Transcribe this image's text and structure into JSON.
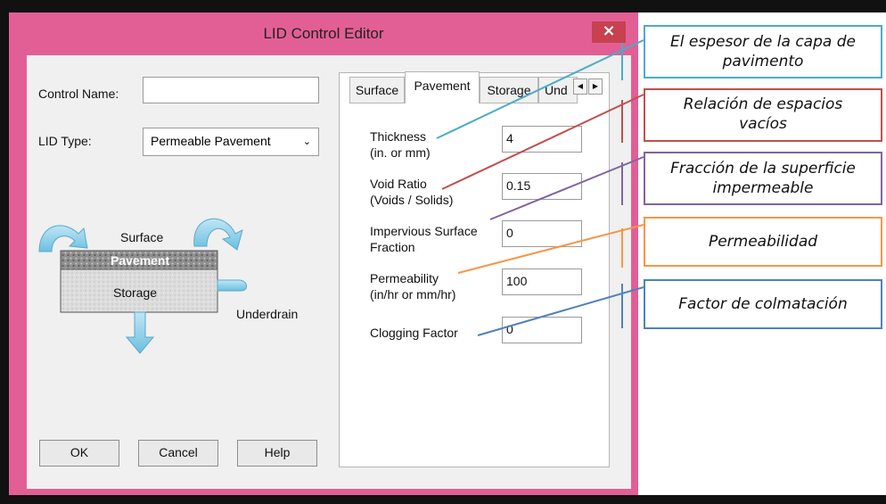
{
  "window": {
    "title": "LID Control Editor",
    "close_glyph": "×"
  },
  "form": {
    "control_name_label": "Control Name:",
    "control_name_value": "",
    "lid_type_label": "LID Type:",
    "lid_type_value": "Permeable Pavement"
  },
  "diagram": {
    "surface": "Surface",
    "pavement": "Pavement",
    "storage": "Storage",
    "underdrain": "Underdrain"
  },
  "buttons": {
    "ok": "OK",
    "cancel": "Cancel",
    "help": "Help"
  },
  "tabs": [
    {
      "label": "Surface"
    },
    {
      "label": "Pavement"
    },
    {
      "label": "Storage"
    },
    {
      "label": "Und"
    }
  ],
  "params": [
    {
      "label_1": "Thickness",
      "label_2": "(in. or mm)",
      "value": "4"
    },
    {
      "label_1": "Void Ratio",
      "label_2": "(Voids / Solids)",
      "value": "0.15"
    },
    {
      "label_1": "Impervious Surface",
      "label_2": "Fraction",
      "value": "0"
    },
    {
      "label_1": "Permeability",
      "label_2": "(in/hr or mm/hr)",
      "value": "100"
    },
    {
      "label_1": "Clogging Factor",
      "label_2": "",
      "value": "0"
    }
  ],
  "callouts": [
    {
      "line_1": "El espesor de la capa de",
      "line_2": "pavimento",
      "color": "#4bacc6"
    },
    {
      "line_1": "Relación de espacios",
      "line_2": "vacíos",
      "color": "#c0504d"
    },
    {
      "line_1": "Fracción de la superficie",
      "line_2": "impermeable",
      "color": "#8064a2"
    },
    {
      "line_1": "Permeabilidad",
      "line_2": "",
      "color": "#f79646"
    },
    {
      "line_1": "Factor de colmatación",
      "line_2": "",
      "color": "#4f81bd"
    }
  ],
  "colors": {
    "window_frame": "#e25f95",
    "close_button": "#c7414f",
    "client_bg": "#f0f0f0"
  },
  "icons": {
    "close": "close-icon",
    "dropdown": "chevron-down-icon",
    "scroll_left": "arrow-left-icon",
    "scroll_right": "arrow-right-icon"
  }
}
